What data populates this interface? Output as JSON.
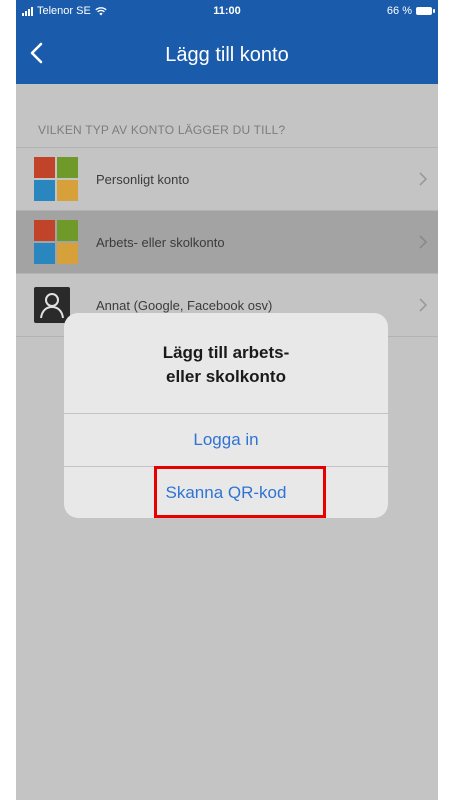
{
  "status_bar": {
    "carrier": "Telenor SE",
    "time": "11:00",
    "battery": "66 %"
  },
  "nav": {
    "title": "Lägg till konto"
  },
  "section": {
    "header": "VILKEN TYP AV KONTO LÄGGER DU TILL?"
  },
  "accounts": [
    {
      "label": "Personligt konto",
      "icon": "microsoft-logo-icon"
    },
    {
      "label": "Arbets- eller skolkonto",
      "icon": "microsoft-logo-icon"
    },
    {
      "label": "Annat (Google, Facebook osv)",
      "icon": "person-icon"
    }
  ],
  "dialog": {
    "title_line1": "Lägg till arbets-",
    "title_line2": "eller skolkonto",
    "sign_in": "Logga in",
    "scan_qr": "Skanna QR-kod"
  },
  "colors": {
    "brand_blue": "#1a5bab",
    "link_blue": "#2f74d2",
    "highlight_red": "#e60000",
    "ms_red": "#f25022",
    "ms_green": "#7fba00",
    "ms_blue": "#00a4ef",
    "ms_yellow": "#ffb900"
  }
}
